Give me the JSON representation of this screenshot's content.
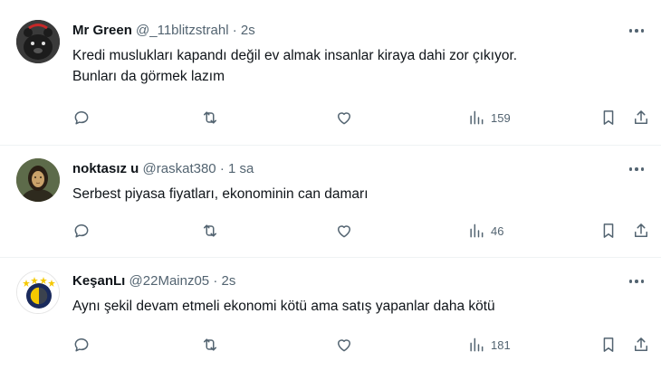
{
  "tweets": [
    {
      "name": "Mr Green",
      "handle": "@_11blitzstrahl",
      "separator": "·",
      "time": "2s",
      "lines": [
        "Kredi muslukları kapandı değil ev almak insanlar kiraya dahi zor çıkıyor.",
        "Bunları da görmek lazım"
      ],
      "views": "159",
      "avatar_color": "#2b2b2b"
    },
    {
      "name": "noktasız u",
      "handle": "@raskat380",
      "separator": "·",
      "time": "1 sa",
      "lines": [
        "Serbest piyasa fiyatları, ekonominin can damarı"
      ],
      "views": "46",
      "avatar_color": "#6b5a3a"
    },
    {
      "name": "KeşanLı",
      "handle": "@22Mainz05",
      "separator": "·",
      "time": "2s",
      "lines": [
        "Aynı şekil devam etmeli ekonomi kötü ama satış yapanlar daha kötü"
      ],
      "views": "181",
      "avatar_color": "#1a2a5c"
    }
  ],
  "colors": {
    "text": "#0f1419",
    "muted": "#536471",
    "divider": "#eff3f4",
    "fb_yellow": "#f5c800",
    "fb_navy": "#1a2a5c"
  }
}
